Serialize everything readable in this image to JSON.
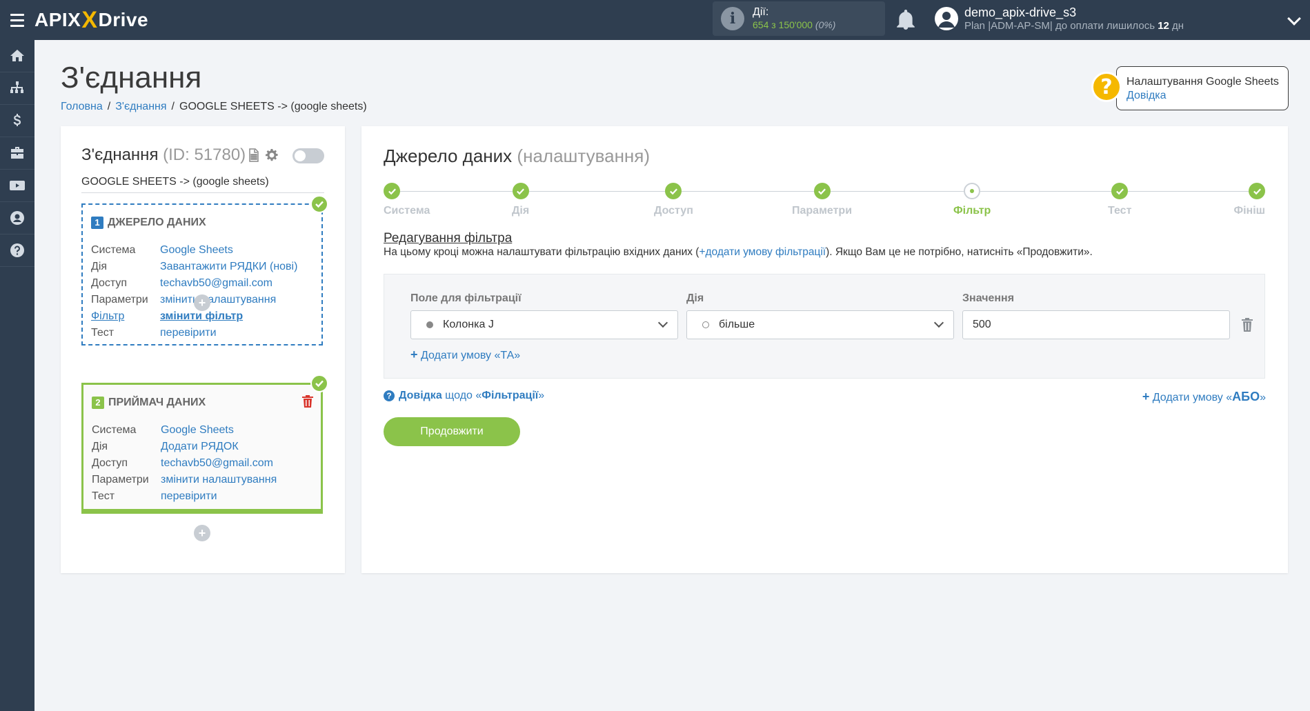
{
  "app": {
    "logo_left": "APIX",
    "logo_x": "X",
    "logo_right": "Drive"
  },
  "topbar": {
    "actions_label": "Дії:",
    "actions_count": "654 з 150'000",
    "actions_pct": "(0%)",
    "user_name": "demo_apix-drive_s3",
    "plan_text": "Plan |ADM-AP-SM| до оплати лишилось",
    "plan_days": "12",
    "plan_days_unit": "дн"
  },
  "sidebar": {
    "items": [
      "home-icon",
      "sitemap-icon",
      "dollar-icon",
      "briefcase-icon",
      "video-icon",
      "user-icon",
      "help-icon"
    ]
  },
  "page": {
    "title": "З'єднання",
    "breadcrumb": [
      "Головна",
      "З'єднання",
      "GOOGLE SHEETS -> (google sheets)"
    ]
  },
  "help_card": {
    "title": "Налаштування Google Sheets",
    "link": "Довідка"
  },
  "connection": {
    "title": "З'єднання",
    "id_text": "(ID: 51780)",
    "name": "GOOGLE SHEETS -> (google sheets)",
    "source": {
      "num": "1",
      "title": "ДЖЕРЕЛО ДАНИХ",
      "rows": [
        {
          "k": "Система",
          "v": "Google Sheets"
        },
        {
          "k": "Дія",
          "v": "Завантажити РЯДКИ (нові)"
        },
        {
          "k": "Доступ",
          "v": "techavb50@gmail.com"
        },
        {
          "k": "Параметри",
          "v": "змінити налаштування"
        },
        {
          "k": "Фільтр",
          "v": "змінити фільтр"
        },
        {
          "k": "Тест",
          "v": "перевірити"
        }
      ]
    },
    "dest": {
      "num": "2",
      "title": "ПРИЙМАЧ ДАНИХ",
      "rows": [
        {
          "k": "Система",
          "v": "Google Sheets"
        },
        {
          "k": "Дія",
          "v": "Додати РЯДОК"
        },
        {
          "k": "Доступ",
          "v": "techavb50@gmail.com"
        },
        {
          "k": "Параметри",
          "v": "змінити налаштування"
        },
        {
          "k": "Тест",
          "v": "перевірити"
        }
      ]
    },
    "plus": "+"
  },
  "main": {
    "title": "Джерело даних",
    "subtitle": "(налаштування)",
    "steps": [
      {
        "label": "Система",
        "done": true
      },
      {
        "label": "Дія",
        "done": true
      },
      {
        "label": "Доступ",
        "done": true
      },
      {
        "label": "Параметри",
        "done": true
      },
      {
        "label": "Фільтр",
        "current": true
      },
      {
        "label": "Тест",
        "done": true
      },
      {
        "label": "Фініш",
        "done": true
      }
    ],
    "filter_heading": "Редагування фільтра",
    "desc_before": "На цьому кроці можна налаштувати фільтрацію вхідних даних (",
    "desc_link": "+додати умову фільтрації",
    "desc_after": "). Якщо Вам це не потрібно, натисніть «Продовжити».",
    "field_label": "Поле для фільтрації",
    "field_value": "Колонка J",
    "action_label": "Дія",
    "action_value": "більше",
    "value_label": "Значення",
    "value_value": "500",
    "add_and_plus": "+",
    "add_and": "Додати умову «ТА»",
    "help_q": "?",
    "help_prefix": "Довідка",
    "help_mid": "щодо «",
    "help_bold": "Фільтрації",
    "help_suffix": "»",
    "add_or_plus": "+",
    "add_or_text": "Додати умову «",
    "add_or_bold": "АБО",
    "add_or_end": "»",
    "continue": "Продовжити"
  },
  "colors": {
    "topbar": "#2f3e50",
    "accent_green": "#8bc34a",
    "link_blue": "#2f7cc0",
    "logo_x": "#f5b800"
  }
}
